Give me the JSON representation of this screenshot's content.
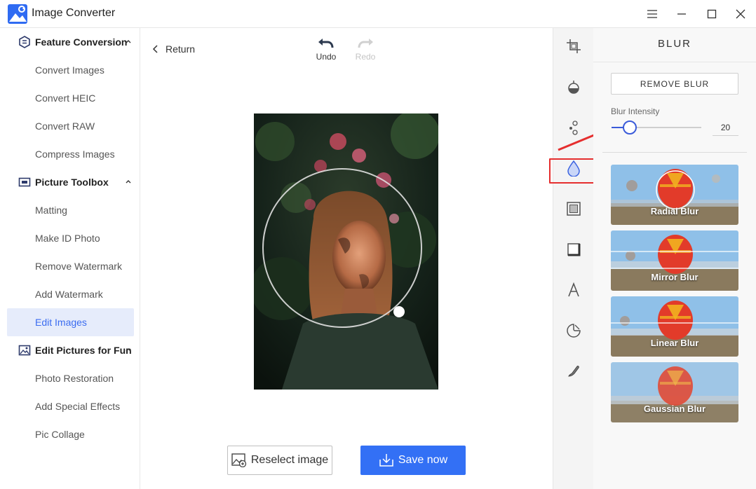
{
  "app": {
    "title": "Image Converter"
  },
  "sidebar": {
    "sections": [
      {
        "label": "Feature Conversion",
        "items": [
          "Convert Images",
          "Convert HEIC",
          "Convert RAW",
          "Compress Images"
        ]
      },
      {
        "label": "Picture Toolbox",
        "items": [
          "Matting",
          "Make ID Photo",
          "Remove Watermark",
          "Add Watermark",
          "Edit Images"
        ]
      },
      {
        "label": "Edit Pictures for Fun",
        "items": [
          "Photo Restoration",
          "Add Special Effects",
          "Pic Collage"
        ]
      }
    ],
    "active_item": "Edit Images"
  },
  "toolbar": {
    "return_label": "Return",
    "undo_label": "Undo",
    "redo_label": "Redo"
  },
  "actions": {
    "reselect_label": "Reselect image",
    "save_label": "Save now"
  },
  "rail": {
    "tools": [
      "crop-icon",
      "adjust-icon",
      "filter-icon",
      "blur-icon",
      "frame-icon",
      "border-icon",
      "text-icon",
      "sticker-icon",
      "brush-icon"
    ],
    "active_tool": "blur-icon"
  },
  "blur_panel": {
    "title": "BLUR",
    "remove_label": "REMOVE BLUR",
    "intensity_label": "Blur Intensity",
    "intensity_value": "20",
    "intensity_fraction": 0.2,
    "presets": [
      "Radial Blur",
      "Mirror Blur",
      "Linear Blur",
      "Gaussian Blur"
    ]
  },
  "colors": {
    "accent": "#3370f5",
    "active_bg": "#e6ecfb",
    "highlight": "#e52e2e",
    "slider": "#3a5bd9"
  }
}
